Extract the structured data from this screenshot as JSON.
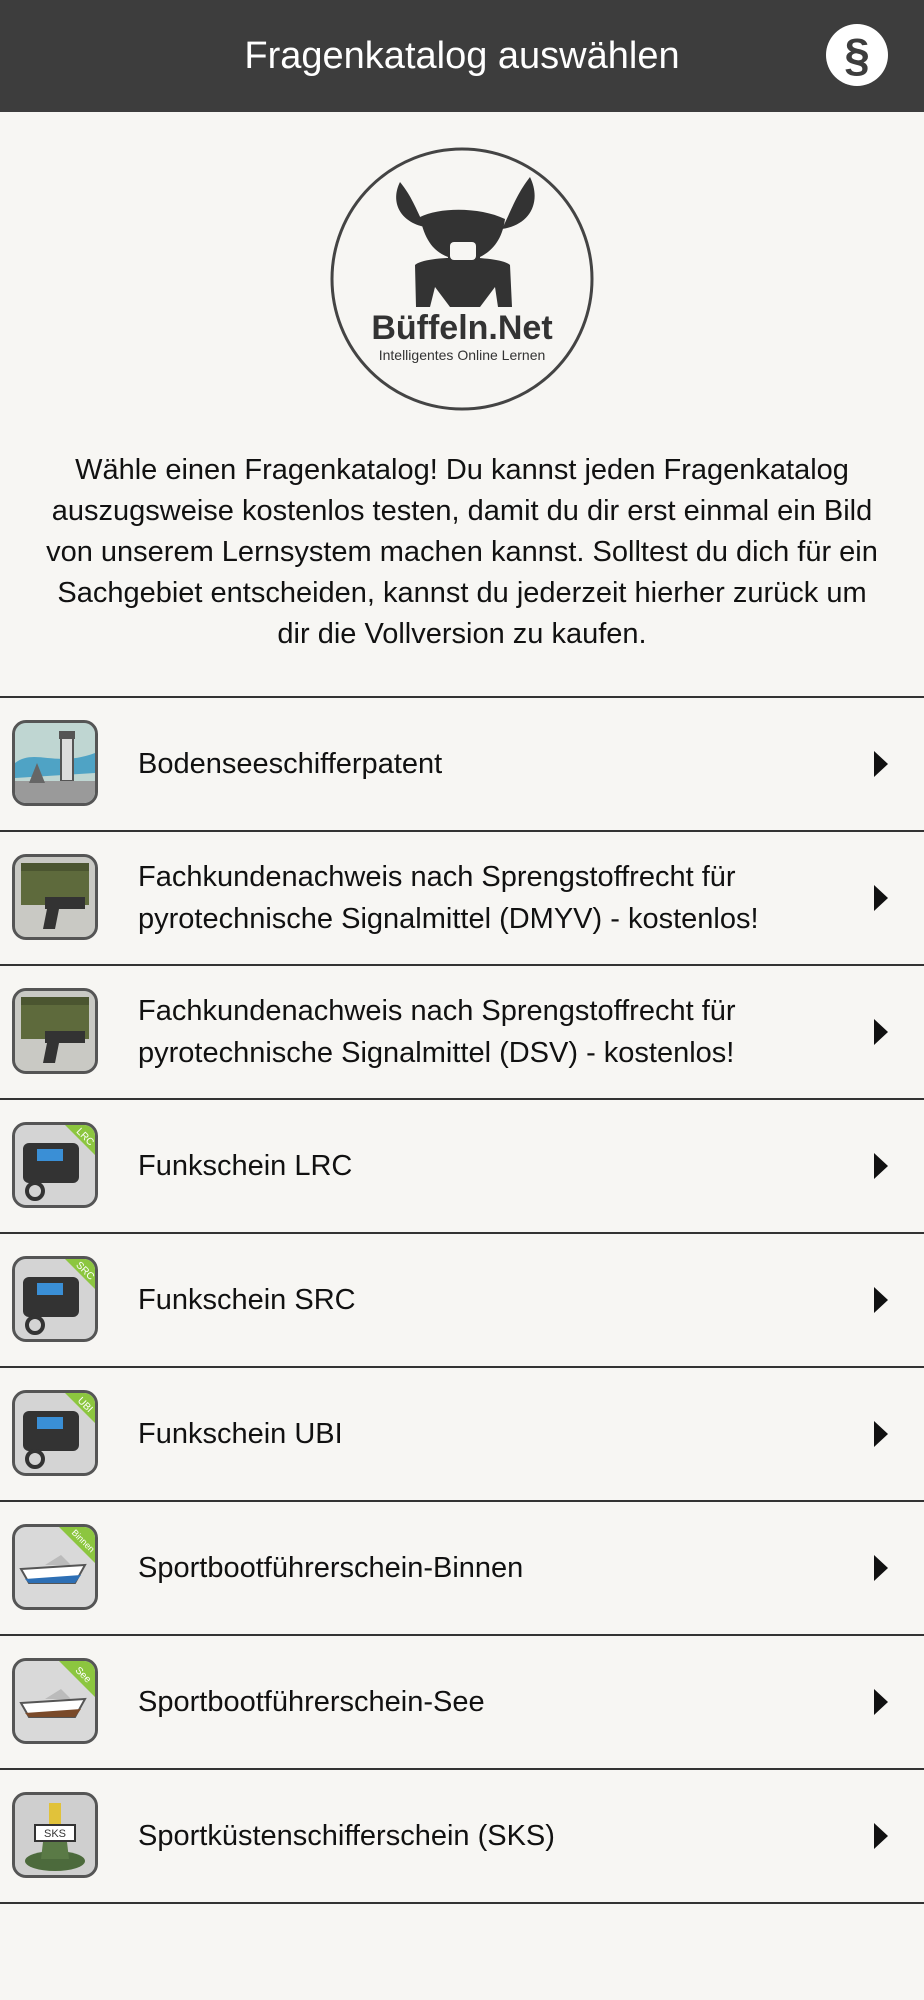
{
  "header": {
    "title": "Fragenkatalog auswählen",
    "legal_icon": "paragraph-icon"
  },
  "logo": {
    "brand": "Büffeln.Net",
    "tagline": "Intelligentes Online Lernen"
  },
  "intro": {
    "text": "Wähle einen Fragenkatalog! Du kannst jeden Fragenkatalog auszugsweise kostenlos testen, damit du dir erst einmal ein Bild von unserem Lernsystem machen kannst. Solltest du dich für ein Sachgebiet entscheiden, kannst du jederzeit hierher zurück um dir die Vollversion zu kaufen."
  },
  "catalogs": [
    {
      "label": "Bodenseeschifferpatent",
      "icon": "lighthouse-icon"
    },
    {
      "label": "Fachkundenachweis nach Sprengstoffrecht für pyrotechnische Signalmittel (DMYV) - kostenlos!",
      "icon": "flare-gun-icon"
    },
    {
      "label": "Fachkundenachweis nach Sprengstoffrecht für pyrotechnische Signalmittel (DSV) - kostenlos!",
      "icon": "flare-gun-icon"
    },
    {
      "label": "Funkschein LRC",
      "icon": "radio-icon",
      "badge": "LRC"
    },
    {
      "label": "Funkschein SRC",
      "icon": "radio-icon",
      "badge": "SRC"
    },
    {
      "label": "Funkschein UBI",
      "icon": "radio-icon",
      "badge": "UBI"
    },
    {
      "label": "Sportbootführerschein-Binnen",
      "icon": "motorboat-icon",
      "badge": "Binnen"
    },
    {
      "label": "Sportbootführerschein-See",
      "icon": "motorboat-icon",
      "badge": "See"
    },
    {
      "label": "Sportküstenschifferschein (SKS)",
      "icon": "buoy-icon",
      "badge": "SKS"
    }
  ],
  "colors": {
    "header_bg": "#3d3d3d",
    "page_bg": "#f7f6f3",
    "badge_green": "#8cc63f"
  }
}
